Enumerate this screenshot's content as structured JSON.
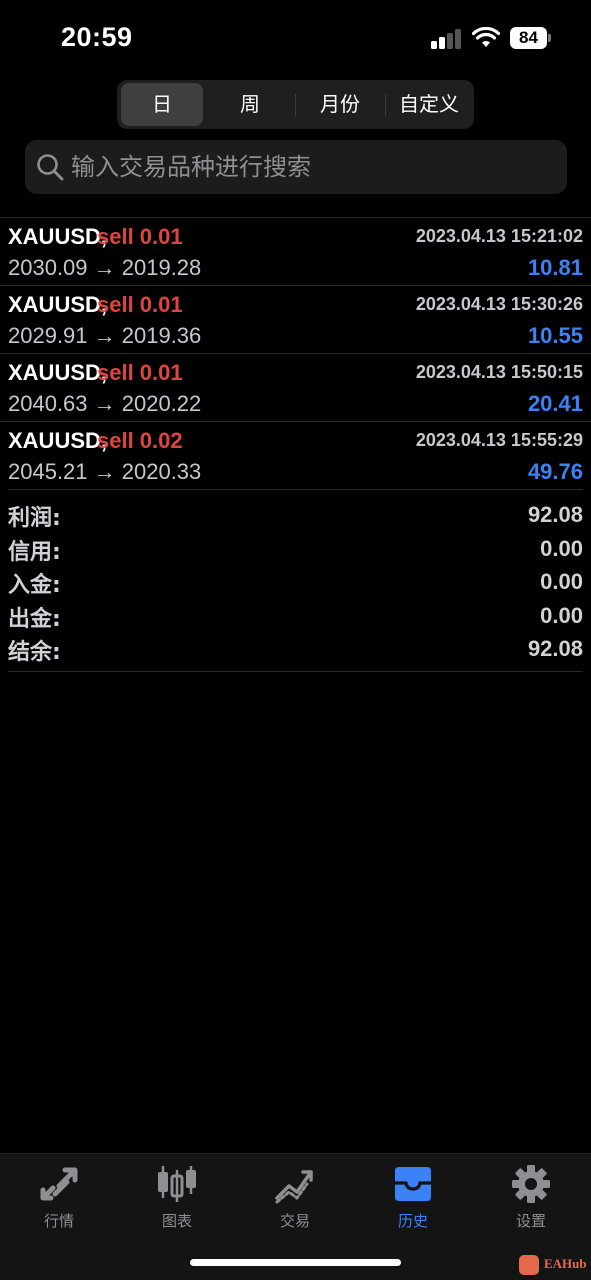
{
  "status_bar": {
    "time": "20:59",
    "battery": "84"
  },
  "period_tabs": [
    {
      "label": "日",
      "active": true
    },
    {
      "label": "周",
      "active": false
    },
    {
      "label": "月份",
      "active": false
    },
    {
      "label": "自定义",
      "active": false
    }
  ],
  "search": {
    "placeholder": "输入交易品种进行搜索",
    "value": ""
  },
  "trades": [
    {
      "symbol": "XAUUSD,",
      "side": "sell 0.01",
      "time": "2023.04.13 15:21:02",
      "prices": "2030.09 → 2019.28",
      "profit": "10.81"
    },
    {
      "symbol": "XAUUSD,",
      "side": "sell 0.01",
      "time": "2023.04.13 15:30:26",
      "prices": "2029.91 → 2019.36",
      "profit": "10.55"
    },
    {
      "symbol": "XAUUSD,",
      "side": "sell 0.01",
      "time": "2023.04.13 15:50:15",
      "prices": "2040.63 → 2020.22",
      "profit": "20.41"
    },
    {
      "symbol": "XAUUSD,",
      "side": "sell 0.02",
      "time": "2023.04.13 15:55:29",
      "prices": "2045.21 → 2020.33",
      "profit": "49.76"
    }
  ],
  "summary": [
    {
      "label": "利润:",
      "value": "92.08"
    },
    {
      "label": "信用:",
      "value": "0.00"
    },
    {
      "label": "入金:",
      "value": "0.00"
    },
    {
      "label": "出金:",
      "value": "0.00"
    },
    {
      "label": "结余:",
      "value": "92.08"
    }
  ],
  "tab_bar": [
    {
      "label": "行情",
      "icon": "quotes-arrows-icon",
      "active": false
    },
    {
      "label": "图表",
      "icon": "candlestick-chart-icon",
      "active": false
    },
    {
      "label": "交易",
      "icon": "trade-trend-icon",
      "active": false
    },
    {
      "label": "历史",
      "icon": "history-inbox-icon",
      "active": true
    },
    {
      "label": "设置",
      "icon": "gear-icon",
      "active": false
    }
  ],
  "watermark": {
    "text": "EAHub"
  },
  "colors": {
    "sell": "#e0443e",
    "profit": "#3b82f6",
    "active_tab": "#3b82f6",
    "inactive": "#8e8e93"
  }
}
